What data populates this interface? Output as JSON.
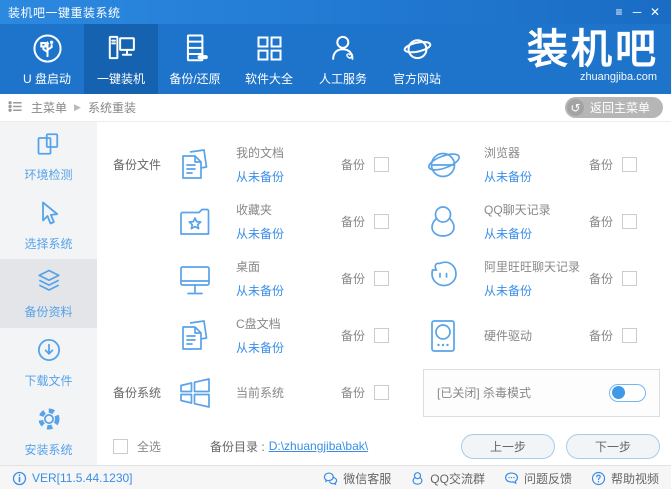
{
  "window": {
    "title": "装机吧一键重装系统",
    "controls": {
      "menu": "≡",
      "minimize": "─",
      "close": "✕"
    }
  },
  "nav": {
    "items": [
      {
        "label": "U 盘启动",
        "icon": "usb-icon",
        "active": false
      },
      {
        "label": "一键装机",
        "icon": "computer-icon",
        "active": true
      },
      {
        "label": "备份/还原",
        "icon": "server-icon",
        "active": false
      },
      {
        "label": "软件大全",
        "icon": "grid-icon",
        "active": false
      },
      {
        "label": "人工服务",
        "icon": "person-icon",
        "active": false
      },
      {
        "label": "官方网站",
        "icon": "globe-icon",
        "active": false
      }
    ],
    "logo": {
      "text": "装机吧",
      "domain": "zhuangjiba.com"
    }
  },
  "breadcrumb": {
    "root": "主菜单",
    "separator": "▶",
    "current": "系统重装",
    "back_icon": "↺",
    "back_button": "返回主菜单"
  },
  "sidebar": {
    "items": [
      {
        "label": "环境检测",
        "icon": "env-check-icon",
        "active": false
      },
      {
        "label": "选择系统",
        "icon": "cursor-icon",
        "active": false
      },
      {
        "label": "备份资料",
        "icon": "layers-icon",
        "active": true
      },
      {
        "label": "下载文件",
        "icon": "download-icon",
        "active": false
      },
      {
        "label": "安装系统",
        "icon": "gear-icon",
        "active": false
      }
    ]
  },
  "main": {
    "backup_files_label": "备份文件",
    "backup_system_label": "备份系统",
    "backup_label": "备份",
    "items": [
      {
        "name": "我的文档",
        "status": "从未备份",
        "icon": "documents-icon",
        "checked": false
      },
      {
        "name": "浏览器",
        "status": "从未备份",
        "icon": "browser-icon",
        "checked": false
      },
      {
        "name": "收藏夹",
        "status": "从未备份",
        "icon": "favorites-folder-icon",
        "checked": false
      },
      {
        "name": "QQ聊天记录",
        "status": "从未备份",
        "icon": "qq-icon",
        "checked": false
      },
      {
        "name": "桌面",
        "status": "从未备份",
        "icon": "desktop-icon",
        "checked": false
      },
      {
        "name": "阿里旺旺聊天记录",
        "status": "从未备份",
        "icon": "wangwang-icon",
        "checked": false
      },
      {
        "name": "C盘文档",
        "status": "从未备份",
        "icon": "documents-icon",
        "checked": false
      },
      {
        "name": "硬件驱动",
        "status": "",
        "icon": "hard-drive-icon",
        "checked": false
      },
      {
        "name": "当前系统",
        "status": "",
        "icon": "windows-icon",
        "checked": false
      }
    ],
    "antivirus": {
      "label": "[已关闭] 杀毒模式",
      "enabled": false
    },
    "select_all_label": "全选",
    "backup_dir_label": "备份目录 :",
    "backup_dir": "D:\\zhuangjiba\\bak\\",
    "prev_button": "上一步",
    "next_button": "下一步"
  },
  "statusbar": {
    "version": "VER[11.5.44.1230]",
    "links": [
      {
        "label": "微信客服",
        "icon": "wechat-icon"
      },
      {
        "label": "QQ交流群",
        "icon": "qq-icon"
      },
      {
        "label": "问题反馈",
        "icon": "feedback-icon"
      },
      {
        "label": "帮助视频",
        "icon": "help-icon"
      }
    ]
  },
  "colors": {
    "titlebar_blue": "#2c89e0",
    "nav_blue": "#1e74cb",
    "nav_active_blue": "#1562b0",
    "accent_blue": "#3a8ee6",
    "icon_blue": "#5aa3e9",
    "sidebar_bg": "#f3f4f6",
    "sidebar_active_bg": "#e3e5e8"
  }
}
